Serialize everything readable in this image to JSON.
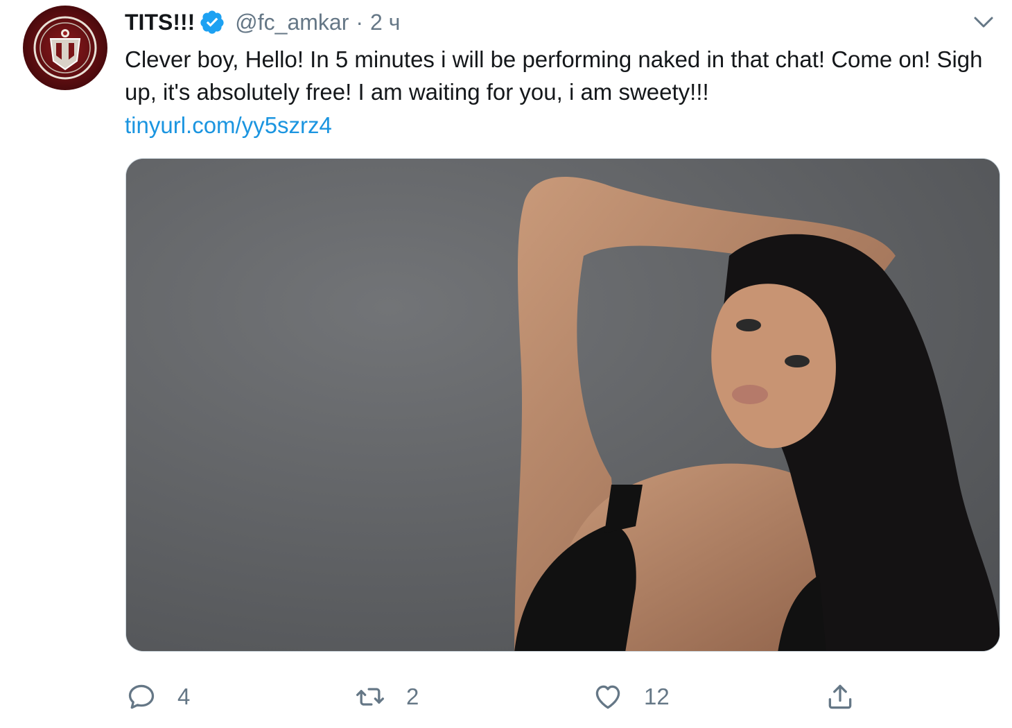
{
  "tweet": {
    "display_name": "TITS!!!",
    "handle": "@fc_amkar",
    "separator": "·",
    "time": "2 ч",
    "text": "Clever boy, Hello! In 5 minutes i will be performing naked in that chat! Come on! Sigh up, it's absolutely free! I am waiting for you, i am sweety!!!",
    "link": "tinyurl.com/yy5szrz4"
  },
  "actions": {
    "reply_count": "4",
    "retweet_count": "2",
    "like_count": "12"
  },
  "icons": {
    "verified": "verified-badge-icon",
    "caret": "chevron-down-icon",
    "reply": "speech-bubble-icon",
    "retweet": "retweet-arrows-icon",
    "like": "heart-icon",
    "share": "share-upload-icon"
  },
  "colors": {
    "link": "#1b95e0",
    "secondary_text": "#657786",
    "verified": "#1da1f2",
    "avatar": "#8a1a1d"
  }
}
